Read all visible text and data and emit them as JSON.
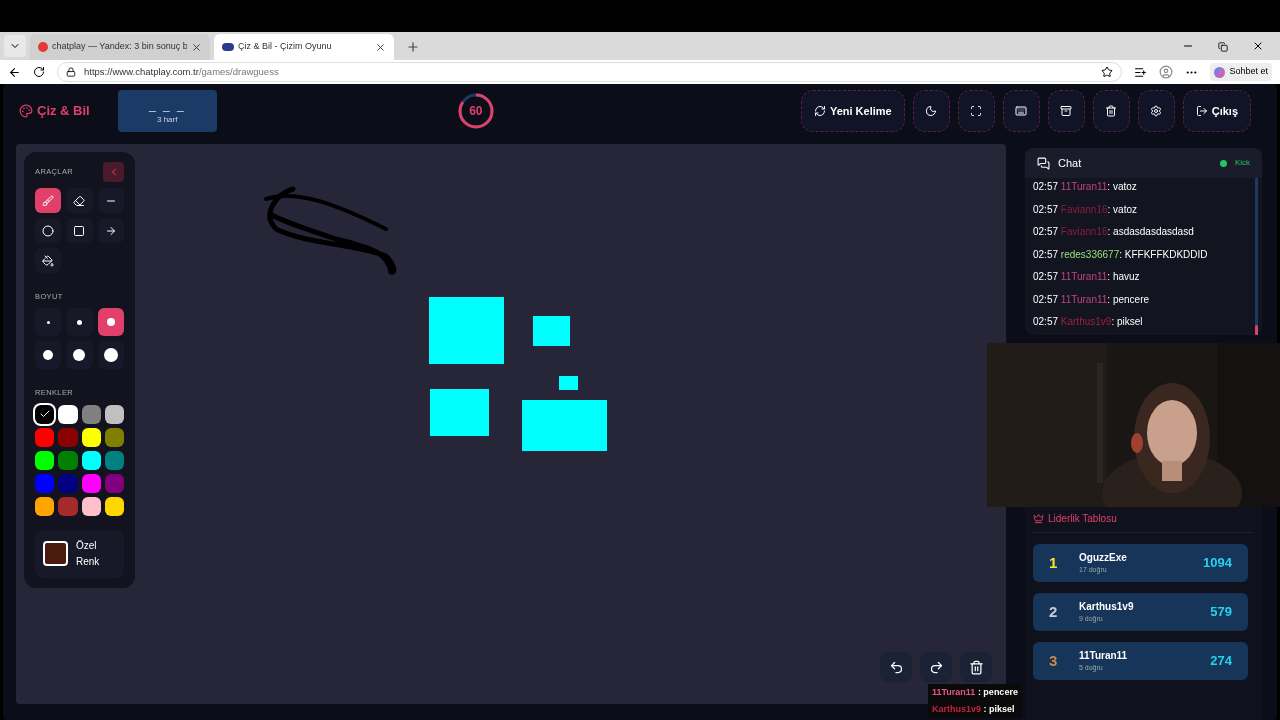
{
  "browser": {
    "tabs": [
      {
        "title": "chatplay — Yandex: 3 bin sonuç b",
        "selected": false,
        "kind": "yandex"
      },
      {
        "title": "Çiz & Bil - Çizim Oyunu",
        "selected": true,
        "kind": "site"
      }
    ],
    "url_host": "https://www.chatplay.com.tr",
    "url_path": "/games/drawguess",
    "chat_button": "Sohbet et"
  },
  "header": {
    "logo": "Çiz & Bil",
    "word": "_ _ _",
    "word_hint": "3 harf",
    "timer": {
      "text": "60",
      "level": 0.84
    },
    "buttons": [
      {
        "kind": "new-word",
        "label": "Yeni Kelime"
      },
      {
        "kind": "theme"
      },
      {
        "kind": "fullscreen"
      },
      {
        "kind": "keyboard"
      },
      {
        "kind": "archive"
      },
      {
        "kind": "trash"
      },
      {
        "kind": "settings"
      },
      {
        "kind": "logout",
        "label": "Çıkış"
      }
    ]
  },
  "toolbox": {
    "title": "ARAÇLAR",
    "tools": [
      {
        "kind": "brush",
        "selected": true
      },
      {
        "kind": "eraser",
        "selected": false
      },
      {
        "kind": "line",
        "selected": false
      },
      {
        "kind": "circle",
        "selected": false
      },
      {
        "kind": "rect",
        "selected": false
      },
      {
        "kind": "arrow",
        "selected": false
      },
      {
        "kind": "fill",
        "selected": false
      }
    ],
    "size_title": "BOYUT",
    "sizes": [
      {
        "selected": false
      },
      {
        "selected": false
      },
      {
        "selected": true
      },
      {
        "selected": false
      },
      {
        "selected": false
      },
      {
        "selected": false
      }
    ],
    "colors_title": "RENKLER",
    "colors": [
      {
        "color": "#000000",
        "selected": true
      },
      {
        "color": "#ffffff",
        "selected": false
      },
      {
        "color": "#808080",
        "selected": false
      },
      {
        "color": "#c0c0c0",
        "selected": false
      },
      {
        "color": "#ff0000",
        "selected": false
      },
      {
        "color": "#8b0000",
        "selected": false
      },
      {
        "color": "#ffff00",
        "selected": false
      },
      {
        "color": "#808000",
        "selected": false
      },
      {
        "color": "#00ff00",
        "selected": false
      },
      {
        "color": "#008000",
        "selected": false
      },
      {
        "color": "#00ffff",
        "selected": false
      },
      {
        "color": "#008080",
        "selected": false
      },
      {
        "color": "#0000ff",
        "selected": false
      },
      {
        "color": "#000080",
        "selected": false
      },
      {
        "color": "#ff00ff",
        "selected": false
      },
      {
        "color": "#800080",
        "selected": false
      },
      {
        "color": "#ffa500",
        "selected": false
      },
      {
        "color": "#a52a2a",
        "selected": false
      },
      {
        "color": "#ffc0cb",
        "selected": false
      },
      {
        "color": "#ffd700",
        "selected": false
      }
    ],
    "custom": {
      "label_1": "Özel",
      "label_2": "Renk",
      "color": "#4a1a0e"
    }
  },
  "chat": {
    "title": "Chat",
    "status": "Kick",
    "messages": [
      {
        "time": "02:57",
        "user": "11Turan11",
        "color": "#c2467a",
        "text": ": vatoz"
      },
      {
        "time": "02:57",
        "user": "Faviann16",
        "color": "#8b1d3f",
        "text": ": vatoz"
      },
      {
        "time": "02:57",
        "user": "Faviann16",
        "color": "#8b1d3f",
        "text": ": asdasdasdasdasd"
      },
      {
        "time": "02:57",
        "user": "redes336677",
        "color": "#9be27a",
        "text": ": KFFKFFKDKDDID"
      },
      {
        "time": "02:57",
        "user": "11Turan11",
        "color": "#c2467a",
        "text": ": havuz"
      },
      {
        "time": "02:57",
        "user": "11Turan11",
        "color": "#c2467a",
        "text": ": pencere"
      },
      {
        "time": "02:57",
        "user": "Karthus1v9",
        "color": "#a0203f",
        "text": ": piksel"
      }
    ]
  },
  "leaderboard": {
    "title": "Liderlik Tablosu",
    "rows": [
      {
        "rank": "1",
        "color": "#f5e32a",
        "name": "OguzzExe",
        "correct": "17 doğru",
        "score": "1094"
      },
      {
        "rank": "2",
        "color": "#c8cdd6",
        "name": "Karthus1v9",
        "correct": "9 doğru",
        "score": "579"
      },
      {
        "rank": "3",
        "color": "#c78a4a",
        "name": "11Turan11",
        "correct": "5 doğru",
        "score": "274"
      }
    ]
  },
  "overlay_chat": [
    {
      "user": "11Turan11",
      "color": "#e2568a",
      "text": " : pencere"
    },
    {
      "user": "Karthus1v9",
      "color": "#c8203f",
      "text": " : piksel"
    }
  ]
}
